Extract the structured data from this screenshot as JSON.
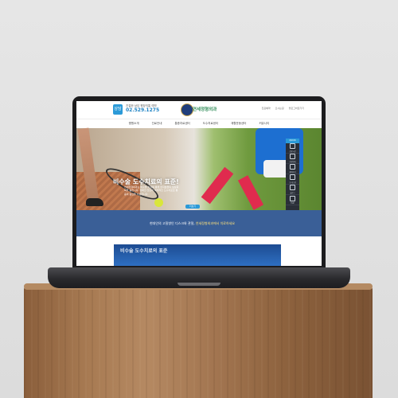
{
  "header": {
    "logo_badge": "상담",
    "sub_text": "친절한 상담 원장직통 예약",
    "phone": "02.529.1275",
    "brand_prefix": "연세",
    "brand_suffix": "정형외과",
    "util_links": [
      "진료예약",
      "오시는길",
      "블로그바로가기"
    ]
  },
  "nav": {
    "items": [
      "병원소개",
      "진료안내",
      "통증치료센터",
      "도수치료센터",
      "재활운동센터",
      "커뮤니티"
    ]
  },
  "hero": {
    "title": "비수술 도수치료의 표준!",
    "text": "연세정형외과는 비수술 치료를 통해 환자분들의 일상회복을 돕습니다. 정확한 진단과 체계적인 도수치료로 통증의 원인을 치료합니다.",
    "button": "더보기"
  },
  "quick_menu": {
    "head": "QUICK",
    "items": [
      "진료시간",
      "진료안내",
      "예약하기",
      "오시는길",
      "블로그",
      "TOP"
    ]
  },
  "band": {
    "text_plain": "현대인의 고질병인 디스크와 관절,",
    "text_highlight": "연세정형외과에서 치료하세요"
  },
  "lower": {
    "panel_title": "비수술 도수치료의 표준"
  },
  "colors": {
    "accent": "#2b9ad8",
    "brand": "#1f3d7a",
    "band": "#3a5f97"
  }
}
